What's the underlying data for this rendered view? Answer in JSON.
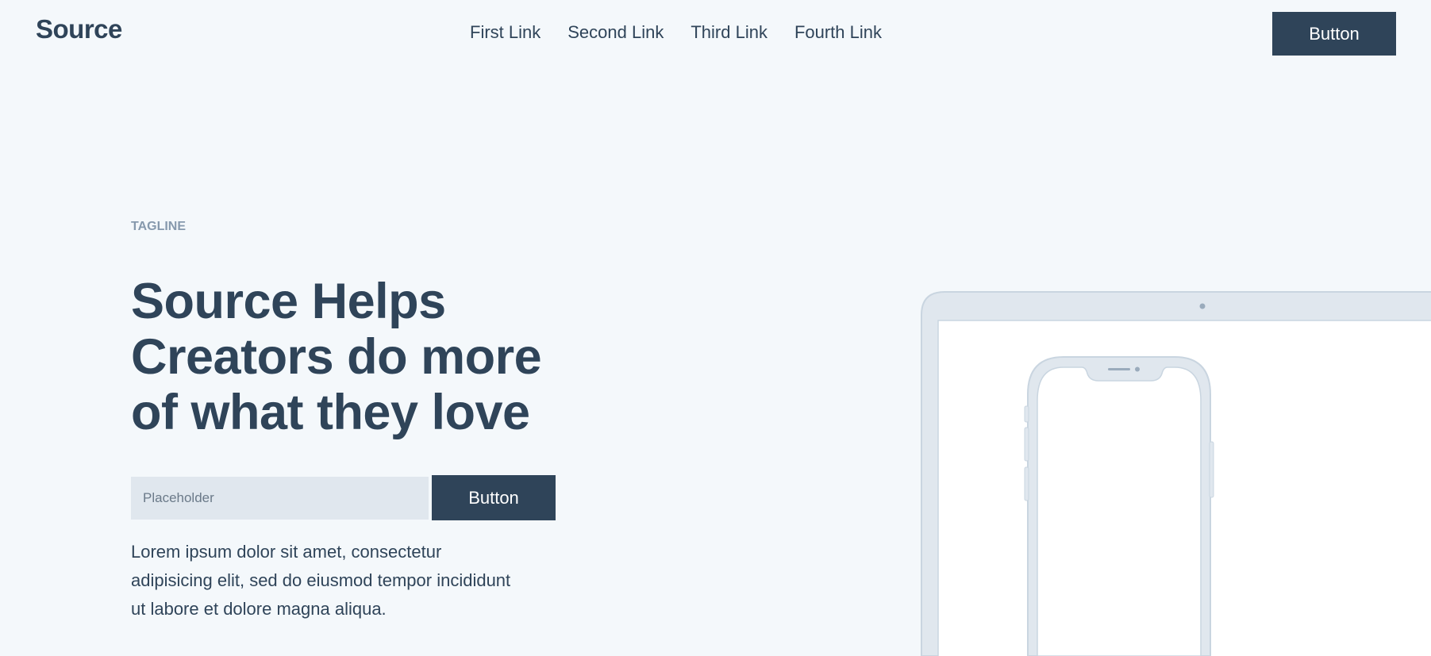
{
  "header": {
    "logo": "Source",
    "nav": [
      "First Link",
      "Second Link",
      "Third Link",
      "Fourth Link"
    ],
    "button": "Button"
  },
  "hero": {
    "tagline": "TAGLINE",
    "headline": "Source Helps Creators do more of what they love",
    "input_placeholder": "Placeholder",
    "button": "Button",
    "paragraph": "Lorem ipsum dolor sit amet, consectetur adipisicing elit, sed do eiusmod tempor incididunt ut labore et dolore magna aliqua."
  },
  "colors": {
    "primary": "#2f4459",
    "background": "#f4f8fb",
    "device": "#e0e7ee"
  }
}
